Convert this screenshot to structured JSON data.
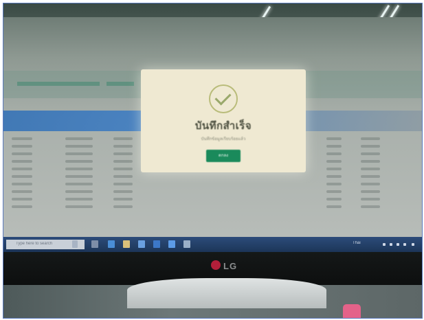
{
  "modal": {
    "icon": "check-circle-icon",
    "title": "บันทึกสำเร็จ",
    "message": "บันทึกข้อมูลเรียบร้อยแล้ว",
    "ok_label": "ตกลง"
  },
  "taskbar": {
    "search_placeholder": "Type here to search",
    "tray_text": "Thai"
  },
  "monitor": {
    "brand": "LG"
  },
  "colors": {
    "table_header": "#2f6fb7",
    "ok_button": "#1a8a5b",
    "modal_bg": "#efe9d2",
    "taskbar": "#1c3558",
    "brand_logo": "#b21f3a"
  }
}
